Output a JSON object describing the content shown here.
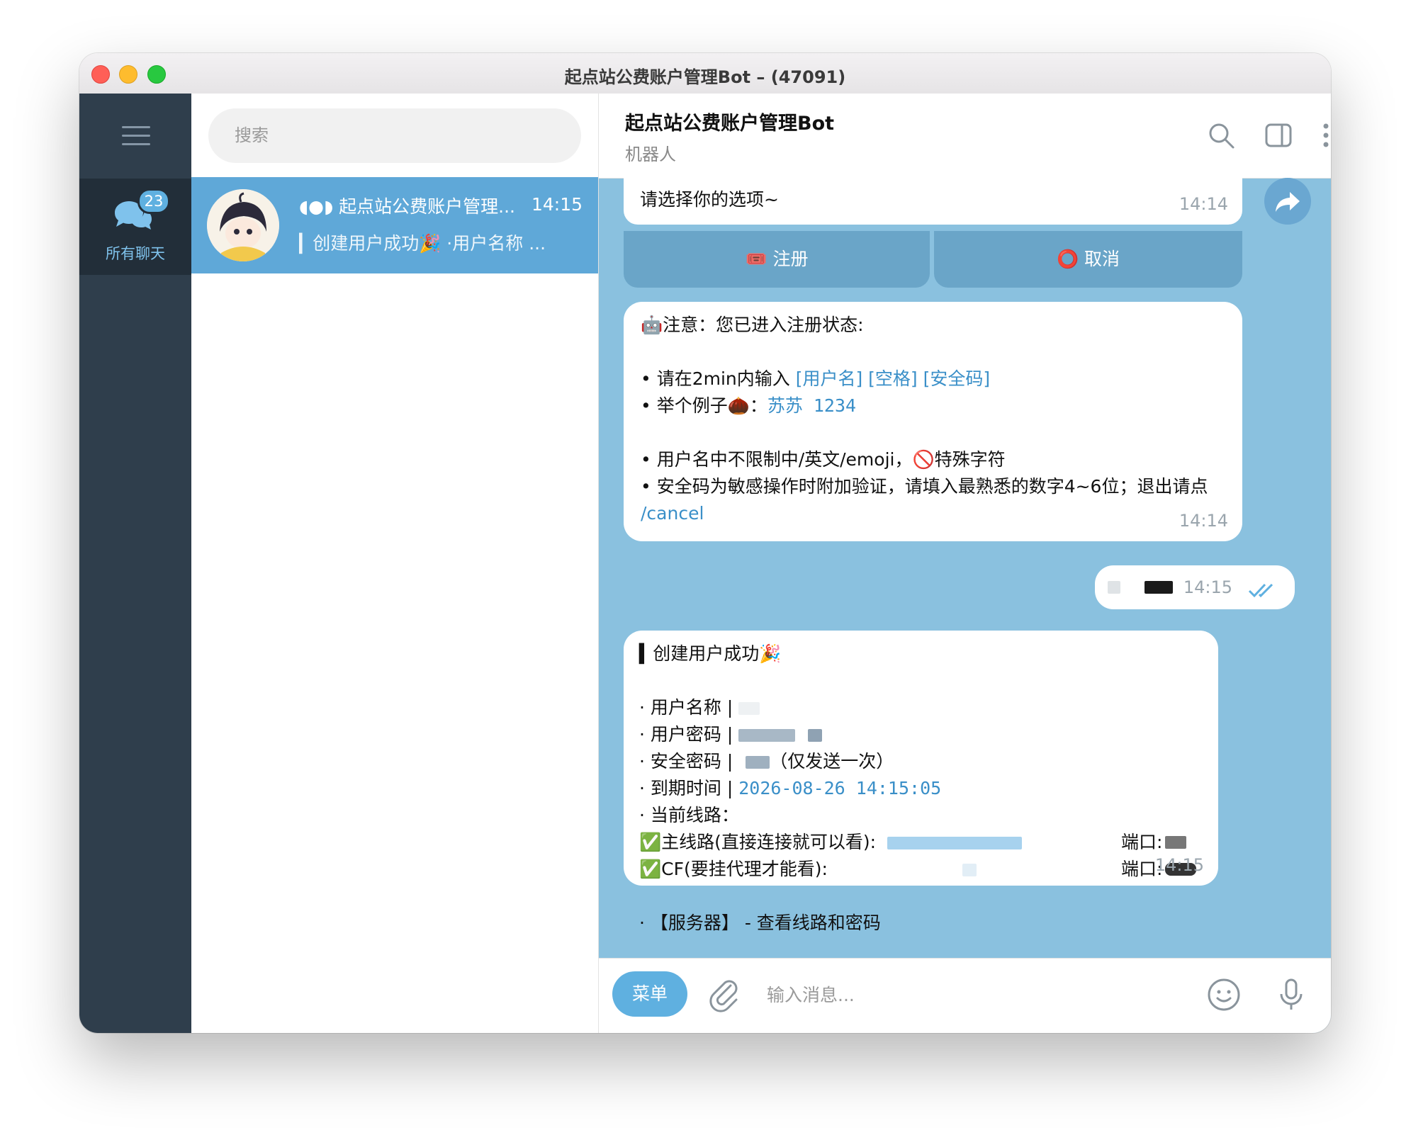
{
  "window": {
    "title": "起点站公费账户管理Bot – (47091)"
  },
  "rail": {
    "folder_badge": "23",
    "folder_label": "所有聊天"
  },
  "chatlist": {
    "search_placeholder": "搜索",
    "items": [
      {
        "title": "起点站公费账户管理...",
        "time": "14:15",
        "preview": "▎创建用户成功🎉 ·用户名称 ..."
      }
    ]
  },
  "chat": {
    "name": "起点站公费账户管理Bot",
    "status": "机器人",
    "messages": {
      "m1": {
        "text": "请选择你的选项~",
        "time": "14:14"
      },
      "keyboard": [
        {
          "label": "🎟️ 注册"
        },
        {
          "label": "⭕ 取消"
        }
      ],
      "m2": {
        "l1": "🤖注意：您已进入注册状态:",
        "l2a": "• 请在2min内输入 ",
        "l2b": "[用户名] [空格] [安全码]",
        "l3a": "• 举个例子🌰：",
        "l3b": "苏苏 1234",
        "l4": "• 用户名中不限制中/英文/emoji，🚫特殊字符",
        "l5": "• 安全码为敏感操作时附加验证，请填入最熟悉的数字4~6位；退出请点 ",
        "l5b": "/cancel",
        "time": "14:14"
      },
      "m3": {
        "time": "14:15"
      },
      "m4": {
        "l1": "▍创建用户成功🎉",
        "l2": "· 用户名称 | ",
        "l3": "· 用户密码 | ",
        "l4": "· 安全密码 | ",
        "l4b": "（仅发送一次）",
        "l5": "· 到期时间 | ",
        "l5b": "2026-08-26 14:15:05",
        "l6": "· 当前线路：",
        "l7": "✅主线路(直接连接就可以看):",
        "l7b": "端口:",
        "l8": "✅CF(要挂代理才能看):",
        "l8b": "端口:",
        "l9": "· 【服务器】 - 查看线路和密码",
        "time": "14:15"
      }
    }
  },
  "inputbar": {
    "menu_label": "菜单",
    "placeholder": "输入消息..."
  },
  "colors": {
    "accent": "#5fb0e0",
    "chat_bg": "#8ac1df",
    "rail_bg": "#2f3e4c",
    "selected_chat": "#5fa8d8"
  }
}
